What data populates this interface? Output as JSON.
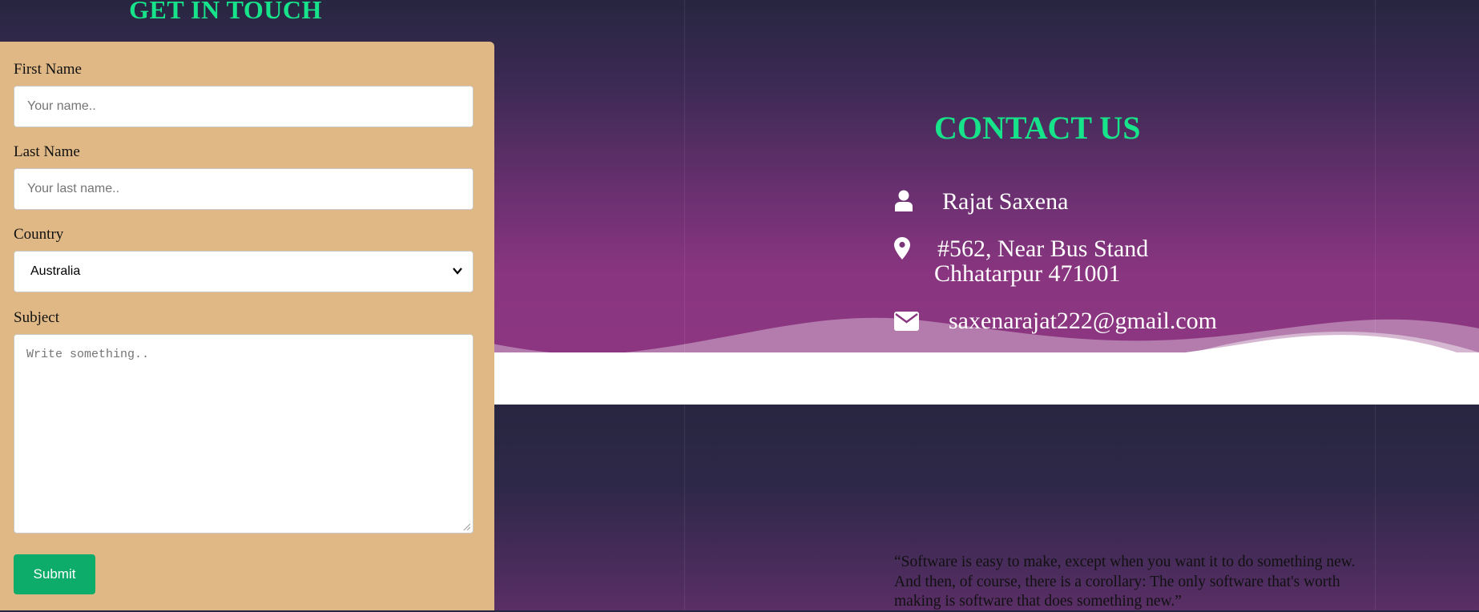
{
  "form": {
    "title": "GET IN TOUCH",
    "first_name_label": "First Name",
    "first_name_placeholder": "Your name..",
    "last_name_label": "Last Name",
    "last_name_placeholder": "Your last name..",
    "country_label": "Country",
    "country_selected": "Australia",
    "subject_label": "Subject",
    "subject_placeholder": "Write something..",
    "submit_label": "Submit"
  },
  "contact": {
    "title": "CONTACT US",
    "name": "Rajat Saxena",
    "address_line1": "#562, Near Bus Stand",
    "address_line2": "Chhatarpur 471001",
    "email": "saxenarajat222@gmail.com"
  },
  "quote": {
    "text": "“Software is easy to make, except when you want it to do something new. And then, of course, there is a corollary: The only software that's worth making is software that does something new.”"
  },
  "colors": {
    "accent_green": "#17e38a",
    "form_background": "#dfb886",
    "submit_button": "#0eac6b",
    "page_dark": "#272640",
    "page_purple": "#8c3682"
  },
  "icons": {
    "name": "user-icon",
    "address": "map-marker-icon",
    "email": "envelope-icon",
    "country_select": "chevron-down-icon"
  }
}
